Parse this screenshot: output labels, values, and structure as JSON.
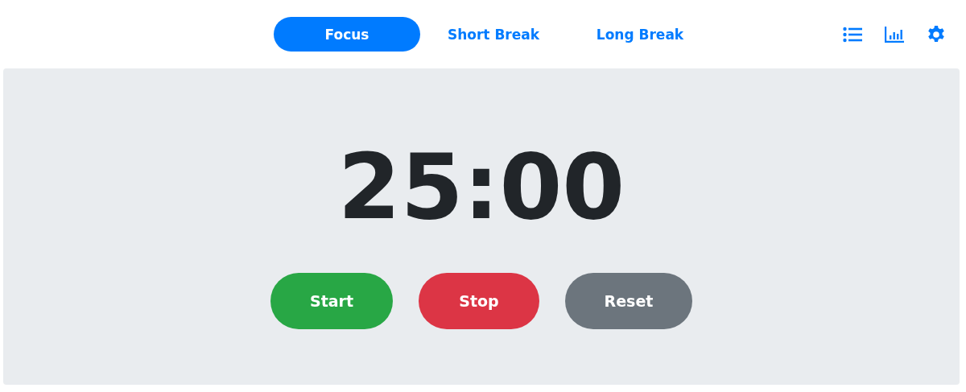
{
  "tabs": [
    {
      "label": "Focus",
      "selected": true
    },
    {
      "label": "Short Break",
      "selected": false
    },
    {
      "label": "Long Break",
      "selected": false
    }
  ],
  "timer": {
    "time": "25:00"
  },
  "buttons": [
    {
      "label": "Start",
      "kind": "start"
    },
    {
      "label": "Stop",
      "kind": "stop"
    },
    {
      "label": "Reset",
      "kind": "reset"
    }
  ]
}
